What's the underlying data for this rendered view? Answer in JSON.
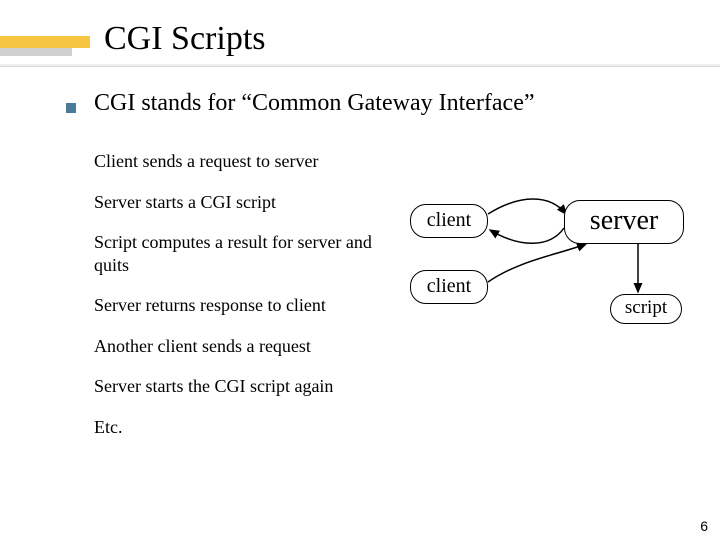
{
  "title": "CGI Scripts",
  "bullet": "CGI stands for “Common Gateway Interface”",
  "steps": {
    "s1": "Client sends a request to server",
    "s2": "Server starts a CGI script",
    "s3": "Script computes a result for server and quits",
    "s4": "Server returns response to client",
    "s5": "Another client sends a request",
    "s6": "Server starts the CGI script again",
    "s7": "Etc."
  },
  "diagram": {
    "client1": "client",
    "client2": "client",
    "server": "server",
    "script": "script"
  },
  "pageNumber": "6"
}
